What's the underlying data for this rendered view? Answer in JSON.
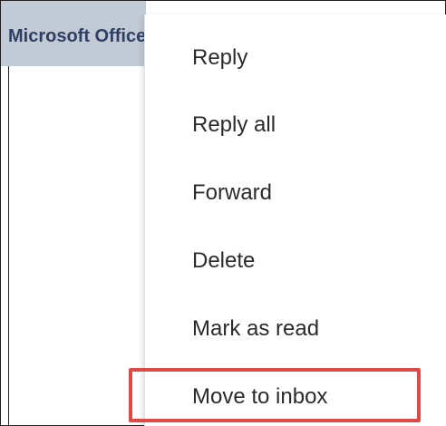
{
  "background": {
    "header_title": "Microsoft Office"
  },
  "context_menu": {
    "items": [
      {
        "label": "Reply"
      },
      {
        "label": "Reply all"
      },
      {
        "label": "Forward"
      },
      {
        "label": "Delete"
      },
      {
        "label": "Mark as read"
      },
      {
        "label": "Move to inbox"
      }
    ]
  },
  "colors": {
    "header_background": "#c2cad6",
    "header_text": "#2e3f63",
    "highlight_border": "#e14949",
    "menu_text": "#2b2b2b"
  }
}
